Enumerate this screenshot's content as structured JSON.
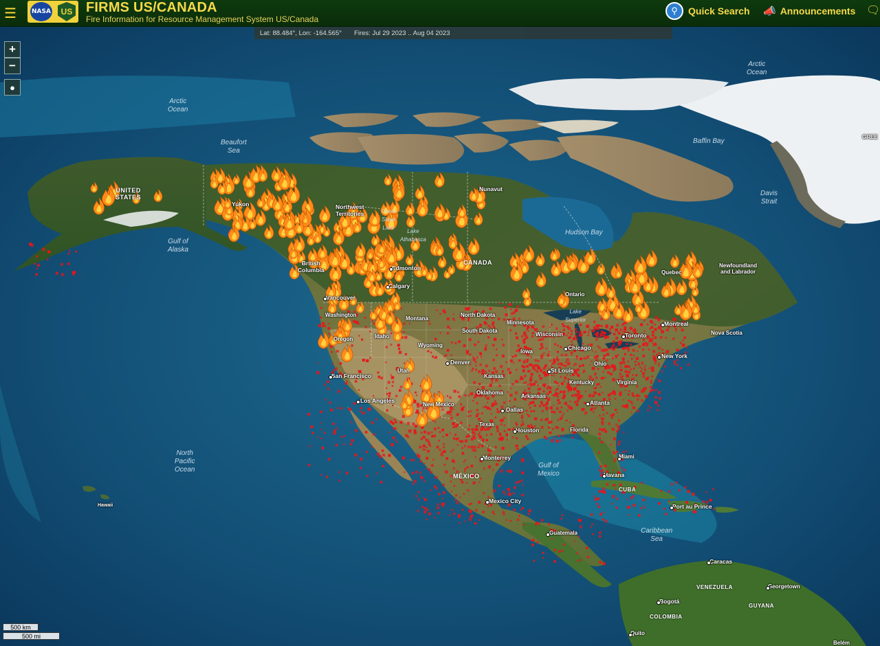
{
  "header": {
    "menu_icon": "hamburger-menu-icon",
    "logo_nasa": "NASA",
    "logo_usfs": "US",
    "title": "FIRMS US/CANADA",
    "subtitle": "Fire Information for Resource Management System US/Canada",
    "quick_search_label": "Quick Search",
    "quick_search_icon": "search-icon",
    "announcements_label": "Announcements",
    "announcements_icon": "megaphone-icon",
    "chat_icon": "chat-icon"
  },
  "status": {
    "coords": "Lat: 88.484°, Lon: -164.565°",
    "fires": "Fires: Jul 29 2023 .. Aug 04 2023"
  },
  "controls": {
    "zoom_in": "+",
    "zoom_out": "−",
    "locate_icon": "location-pin-icon"
  },
  "scale": {
    "km": "500 km",
    "mi": "500 mi"
  },
  "colors": {
    "header_bg": "#0e3a0e",
    "title": "#f6d94a",
    "fire_flame": "#ff8c1a",
    "fire_dot": "#e8151b"
  },
  "map": {
    "water_labels": [
      {
        "key": "arctic_w",
        "text": "Arctic\nOcean"
      },
      {
        "key": "arctic_e",
        "text": "Arctic\nOcean"
      },
      {
        "key": "beaufort",
        "text": "Beaufort\nSea"
      },
      {
        "key": "baffin",
        "text": "Baffin Bay"
      },
      {
        "key": "davis",
        "text": "Davis\nStrait"
      },
      {
        "key": "hudson",
        "text": "Hudson Bay"
      },
      {
        "key": "alaska_gulf",
        "text": "Gulf of\nAlaska"
      },
      {
        "key": "pacific",
        "text": "North\nPacific\nOcean"
      },
      {
        "key": "mexico_gulf",
        "text": "Gulf of\nMexico"
      },
      {
        "key": "caribbean",
        "text": "Caribbean\nSea"
      }
    ],
    "places": {
      "united_states": "UNITED\nSTATES",
      "yukon": "Yukon",
      "nwt": "Northwest\nTerritories",
      "nunavut": "Nunavut",
      "canada": "CANADA",
      "great_slave": "Great\nSlave\nLake",
      "athabasca": "Lake\nAthabasca",
      "edmonton": "Edmonton",
      "calgary": "Calgary",
      "bc": "British\nColumbia",
      "vancouver": "Vancouver",
      "washington": "Washington",
      "oregon": "Oregon",
      "idaho": "Idaho",
      "montana": "Montana",
      "wyoming": "Wyoming",
      "utah": "Utah",
      "denver": "Denver",
      "north_dakota": "North Dakota",
      "south_dakota": "South Dakota",
      "minnesota": "Minnesota",
      "wisconsin": "Wisconsin",
      "lake_superior": "Lake\nSuperior",
      "iowa": "Iowa",
      "chicago": "Chicago",
      "ohio": "Ohio",
      "kansas": "Kansas",
      "st_louis": "St Louis",
      "kentucky": "Kentucky",
      "virginia": "Virginia",
      "oklahoma": "Oklahoma",
      "arkansas": "Arkansas",
      "atlanta": "Atlanta",
      "texas": "Texas",
      "dallas": "Dallas",
      "houston": "Houston",
      "florida": "Florida",
      "miami": "Miami",
      "san_francisco": "San Francisco",
      "los_angeles": "Los Angeles",
      "new_mexico": "New Mexico",
      "ontario": "Ontario",
      "quebec": "Quebec",
      "toronto": "Toronto",
      "montreal": "Montreal",
      "new_york": "New York",
      "nova_scotia": "Nova Scotia",
      "newfoundland": "Newfoundland\nand Labrador",
      "monterrey": "Monterrey",
      "mexico": "MÉXICO",
      "mexico_city": "Mexico City",
      "havana": "Havana",
      "cuba": "CUBA",
      "port_au_prince": "Port au Prince",
      "guatemala": "Guatemala",
      "caracas": "Caracas",
      "venezuela": "VENEZUELA",
      "georgetown": "Georgetown",
      "guyana": "GUYANA",
      "bogota": "Bogotá",
      "colombia": "COLOMBIA",
      "quito": "Quito",
      "belem": "Belém",
      "hawaii": "Hawaii",
      "greenland_clip": "GREE"
    }
  }
}
